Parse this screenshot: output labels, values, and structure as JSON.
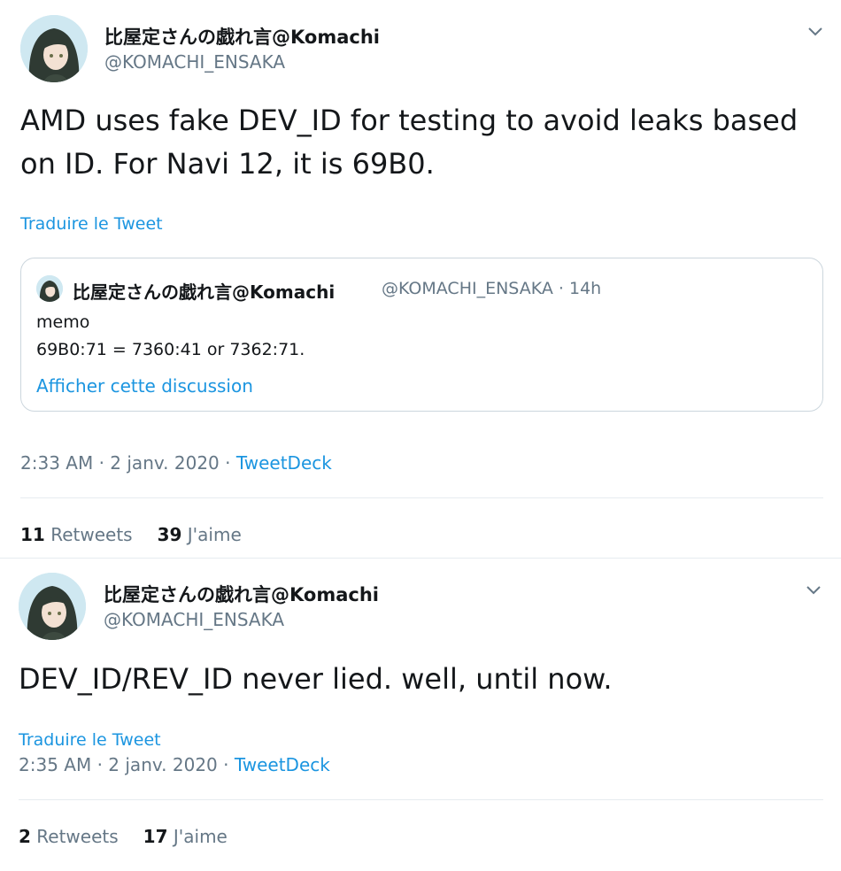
{
  "tweets": [
    {
      "display_name": "比屋定さんの戯れ言@Komachi",
      "handle": "@KOMACHI_ENSAKA",
      "text_line1": "AMD uses fake DEV_ID for testing to avoid leaks based",
      "text_line2": "on ID. For Navi 12, it is 69B0.",
      "translate_label": "Traduire le Tweet",
      "quoted": {
        "display_name": "比屋定さんの戯れ言@Komachi",
        "handle": "@KOMACHI_ENSAKA",
        "time_sep": "·",
        "time": "14h",
        "line1": "memo",
        "line2": "69B0:71 = 7360:41 or 7362:71.",
        "show_thread": "Afficher cette discussion"
      },
      "time": "2:33 AM",
      "date": "2 janv. 2020",
      "source": "TweetDeck",
      "retweets_count": "11",
      "retweets_label": "Retweets",
      "likes_count": "39",
      "likes_label": "J'aime"
    },
    {
      "display_name": "比屋定さんの戯れ言@Komachi",
      "handle": "@KOMACHI_ENSAKA",
      "text_line1": "DEV_ID/REV_ID never lied. well, until now.",
      "translate_label": "Traduire le Tweet",
      "time": "2:35 AM",
      "date": "2 janv. 2020",
      "source": "TweetDeck",
      "retweets_count": "2",
      "retweets_label": "Retweets",
      "likes_count": "17",
      "likes_label": "J'aime"
    }
  ],
  "separator": "·",
  "icons": {
    "avatar": "anime-avatar",
    "menu": "chevron-down-icon"
  },
  "colors": {
    "link": "#1b95e0",
    "secondary_text": "#657786",
    "primary_text": "#14171a",
    "border": "#ccd6dd"
  }
}
